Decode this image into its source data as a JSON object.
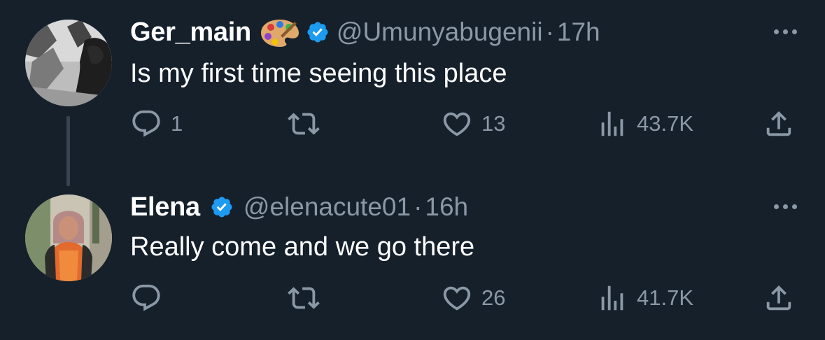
{
  "tweets": [
    {
      "name": "Ger_main",
      "emoji": "artist-palette",
      "handle": "@Umunyabugenii",
      "dot": "·",
      "time": "17h",
      "text": "Is my first time seeing this place",
      "replies": "1",
      "retweets": "",
      "likes": "13",
      "views": "43.7K"
    },
    {
      "name": "Elena",
      "handle": "@elenacute01",
      "dot": "·",
      "time": "16h",
      "text": "Really come and we go there",
      "replies": "",
      "retweets": "",
      "likes": "26",
      "views": "41.7K"
    }
  ],
  "colors": {
    "background": "#15202b",
    "text_primary": "#ffffff",
    "text_secondary": "#8b98a5",
    "verified": "#1d9bf0",
    "thread_line": "#38444d"
  },
  "icons": [
    "reply-icon",
    "retweet-icon",
    "like-icon",
    "views-icon",
    "share-icon",
    "more-icon",
    "verified-badge-icon"
  ]
}
